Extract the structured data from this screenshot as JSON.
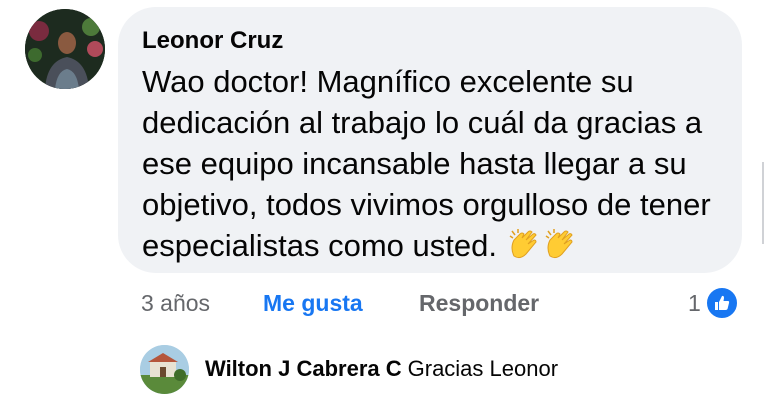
{
  "comment": {
    "author": "Leonor Cruz",
    "text": "Wao doctor! Magnífico excelente su dedicación al trabajo lo cuál da gracias a ese equipo incansable hasta llegar a su objetivo, todos vivimos  orgulloso de tener especialistas como usted.",
    "emoji": [
      "clapping-hands",
      "clapping-hands"
    ],
    "timestamp": "3 años",
    "like_label": "Me gusta",
    "reply_label": "Responder",
    "reaction_count": "1",
    "reaction_icon": "thumbs-up-icon"
  },
  "reply": {
    "author": "Wilton J Cabrera C",
    "text": "Gracias Leonor"
  },
  "colors": {
    "bubble": "#f0f2f5",
    "link_blue": "#1877f2",
    "muted": "#65676b",
    "text": "#050505"
  }
}
